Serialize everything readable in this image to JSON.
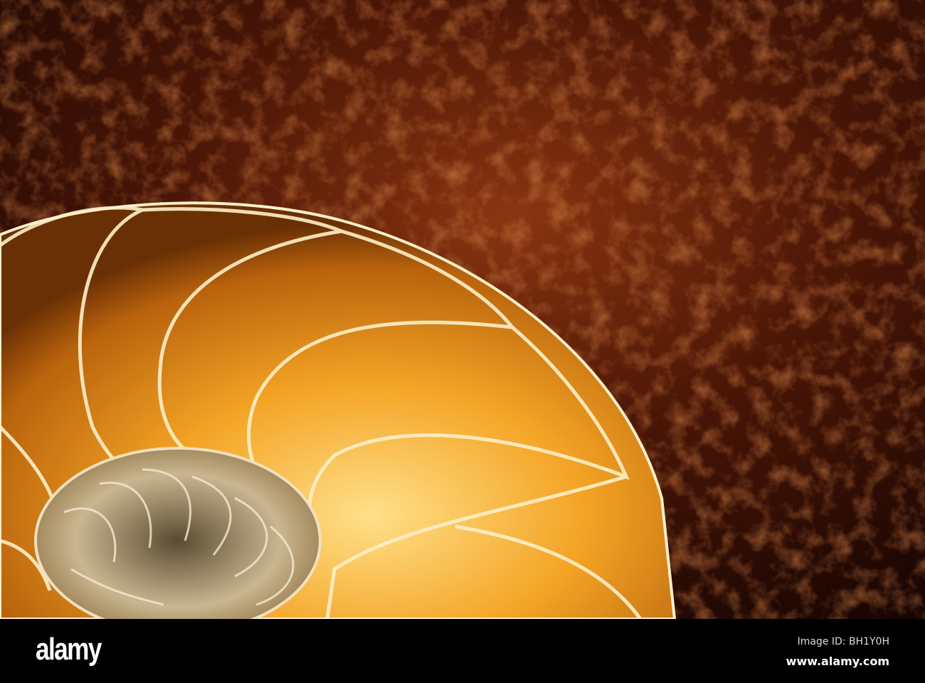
{
  "photo": {
    "subject": "nautilus-shell-on-soil",
    "colors": {
      "soil_dark": "#1a0602",
      "soil_mid": "#7a2a0c",
      "soil_light": "#b5531e",
      "shell_gold": "#f0a020",
      "shell_light": "#ffd27a",
      "shell_edge": "#fff0c8"
    }
  },
  "footer": {
    "logo": "alamy",
    "image_id": "Image ID: BH1Y0H",
    "website": "www.alamy.com"
  }
}
